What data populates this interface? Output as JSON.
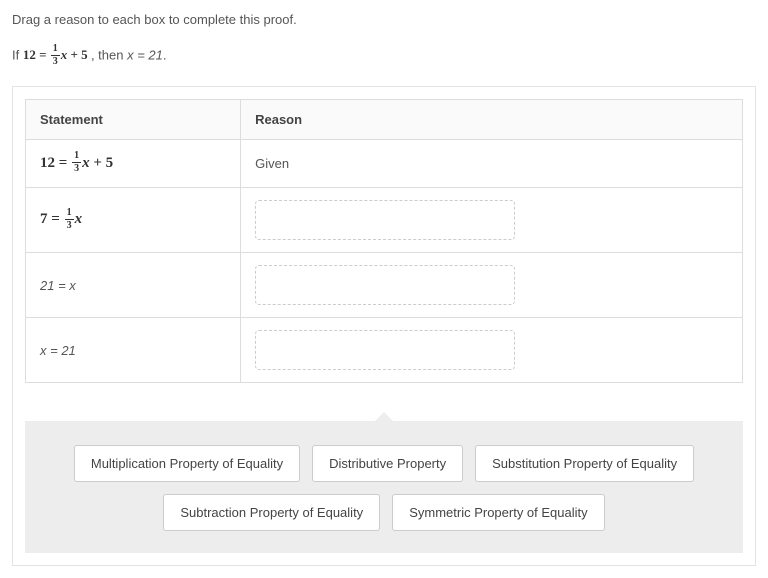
{
  "instruction": "Drag a reason to each box to complete this proof.",
  "premise": {
    "prefix": "If ",
    "eq_lhs": "12",
    "eq_rhs_before": " = ",
    "frac_num": "1",
    "frac_den": "3",
    "eq_rhs_after_var": "x",
    "eq_rhs_tail": " + 5",
    "middle": " , then ",
    "conclusion": "x = 21",
    "suffix": "."
  },
  "table": {
    "headers": {
      "statement": "Statement",
      "reason": "Reason"
    },
    "rows": [
      {
        "statement_type": "math_frac",
        "lhs": "12",
        "sep": " = ",
        "frac_num": "1",
        "frac_den": "3",
        "after_var": "x",
        "tail": " + 5",
        "reason_type": "text",
        "reason": "Given"
      },
      {
        "statement_type": "math_frac",
        "lhs": "7",
        "sep": " = ",
        "frac_num": "1",
        "frac_den": "3",
        "after_var": "x",
        "tail": "",
        "reason_type": "drop"
      },
      {
        "statement_type": "plain",
        "text": "21 = x",
        "reason_type": "drop"
      },
      {
        "statement_type": "plain",
        "text": "x = 21",
        "reason_type": "drop"
      }
    ]
  },
  "chips": {
    "row1": [
      "Multiplication Property of Equality",
      "Distributive Property",
      "Substitution Property of Equality"
    ],
    "row2": [
      "Subtraction Property of Equality",
      "Symmetric Property of Equality"
    ]
  }
}
